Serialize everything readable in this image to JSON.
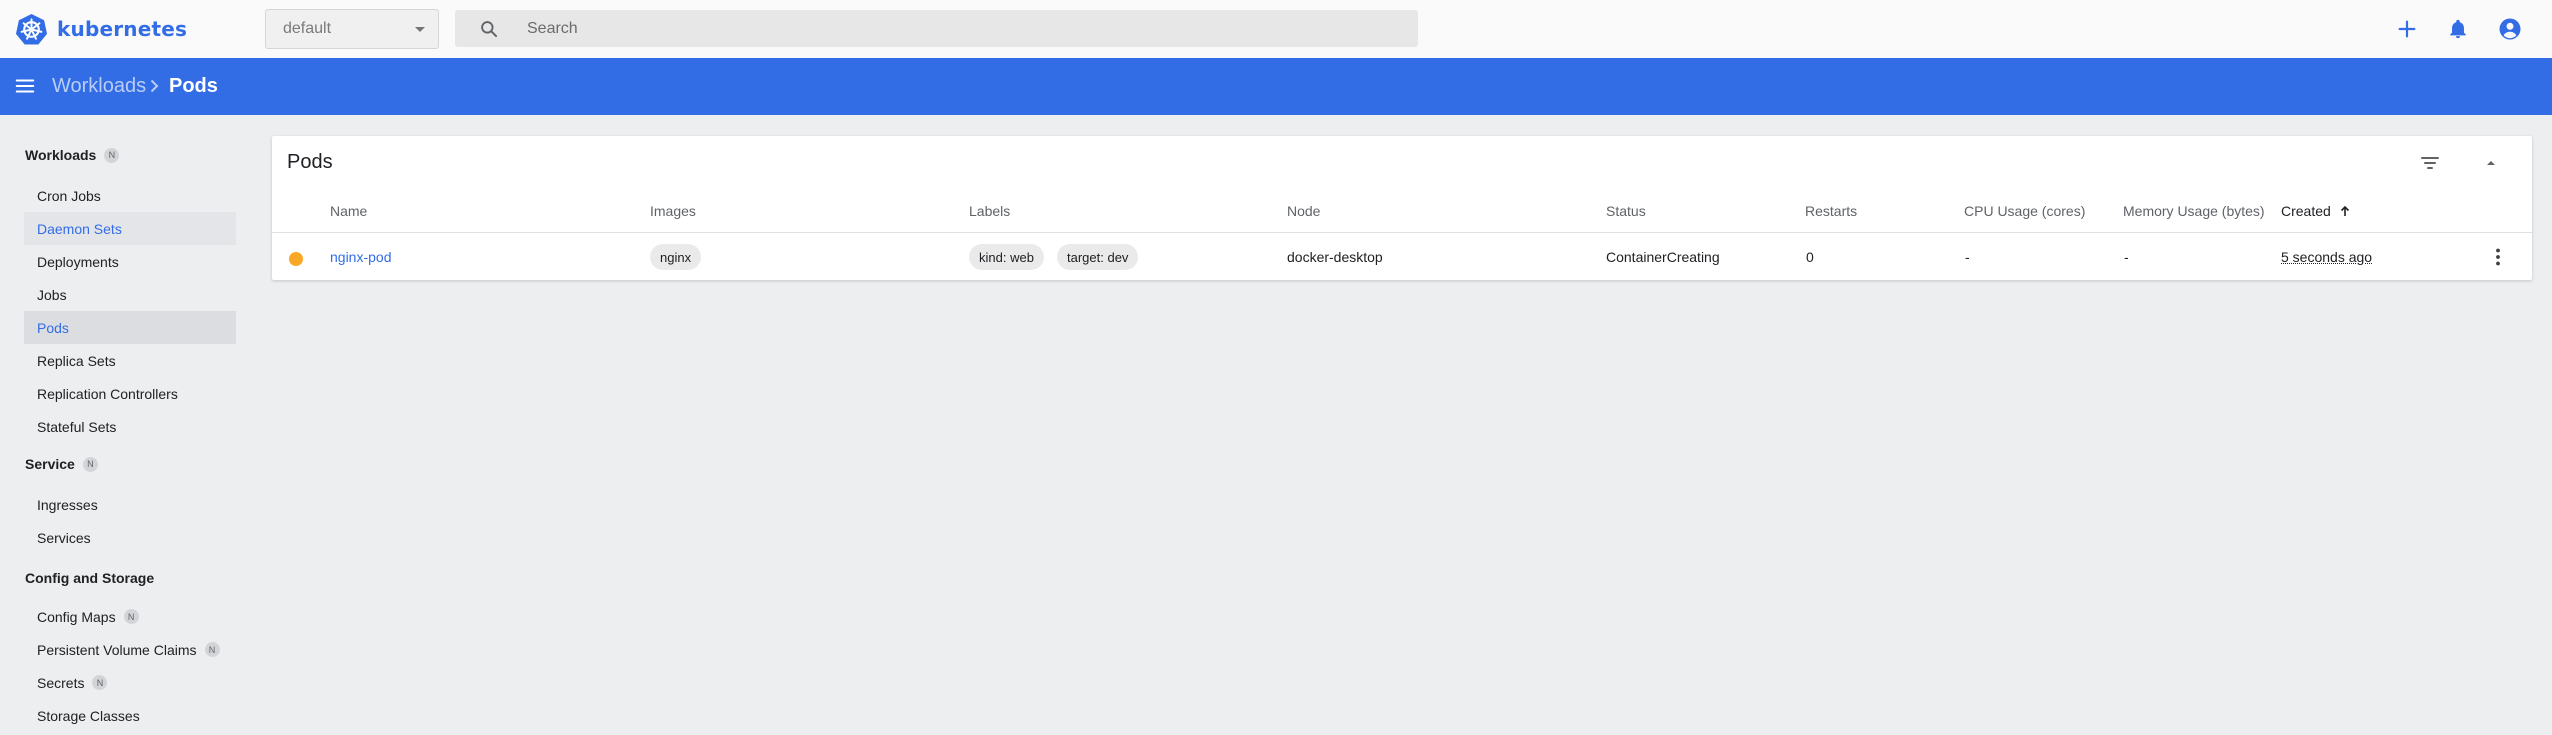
{
  "app": {
    "brand": "kubernetes"
  },
  "namespace": {
    "selected": "default"
  },
  "search": {
    "placeholder": "Search"
  },
  "breadcrumb": {
    "parent": "Workloads",
    "current": "Pods"
  },
  "sidebar": {
    "groups": [
      {
        "label": "Workloads",
        "badge": "N"
      },
      {
        "label": "Service",
        "badge": "N"
      },
      {
        "label": "Config and Storage",
        "badge": ""
      }
    ],
    "workloads": [
      "Cron Jobs",
      "Daemon Sets",
      "Deployments",
      "Jobs",
      "Pods",
      "Replica Sets",
      "Replication Controllers",
      "Stateful Sets"
    ],
    "service": [
      "Ingresses",
      "Services"
    ],
    "config": [
      {
        "label": "Config Maps",
        "badge": "N"
      },
      {
        "label": "Persistent Volume Claims",
        "badge": "N"
      },
      {
        "label": "Secrets",
        "badge": "N"
      },
      {
        "label": "Storage Classes",
        "badge": ""
      }
    ],
    "hovered_item": "Daemon Sets",
    "active_item": "Pods"
  },
  "pods_card": {
    "title": "Pods",
    "columns": [
      "Name",
      "Images",
      "Labels",
      "Node",
      "Status",
      "Restarts",
      "CPU Usage (cores)",
      "Memory Usage (bytes)",
      "Created"
    ],
    "sort_column": "Created",
    "sort_direction": "ascending",
    "rows": [
      {
        "status_color": "#f9a825",
        "name": "nginx-pod",
        "image": "nginx",
        "labels": [
          "kind: web",
          "target: dev"
        ],
        "node": "docker-desktop",
        "status": "ContainerCreating",
        "restarts": "0",
        "cpu": "-",
        "memory": "-",
        "created": "5 seconds ago"
      }
    ]
  },
  "colors": {
    "accent": "#326de6",
    "background": "#edeef0",
    "pending_status": "#f9a825"
  },
  "icons": {
    "logo": "kubernetes-helm-icon",
    "search": "search-icon",
    "create": "plus-icon",
    "notifications": "bell-icon",
    "account": "account-circle-icon",
    "menu": "hamburger-menu-icon",
    "filter": "filter-icon",
    "collapse": "chevron-up-icon",
    "row_actions": "more-vert-icon"
  }
}
